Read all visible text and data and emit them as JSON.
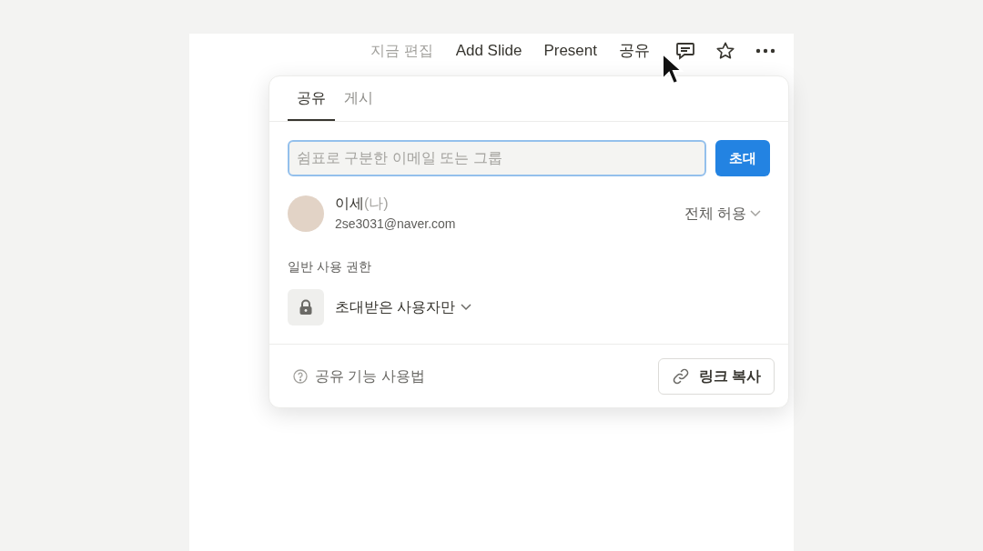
{
  "topbar": {
    "edit_status": "지금 편집",
    "actions": [
      {
        "label": "Add Slide"
      },
      {
        "label": "Present"
      },
      {
        "label": "공유"
      }
    ]
  },
  "share_popup": {
    "tabs": [
      {
        "label": "공유",
        "selected": true
      },
      {
        "label": "게시",
        "selected": false
      }
    ],
    "invite": {
      "placeholder": "쉼표로 구분한 이메일 또는 그룹",
      "button": "초대"
    },
    "members": [
      {
        "name": "이세",
        "suffix": "(나)",
        "email": "2se3031@naver.com",
        "access": "전체 허용"
      }
    ],
    "general_access": {
      "heading": "일반 사용 권한",
      "value": "초대받은 사용자만"
    },
    "footer": {
      "help": "공유 기능 사용법",
      "copy_link": "링크 복사"
    }
  }
}
